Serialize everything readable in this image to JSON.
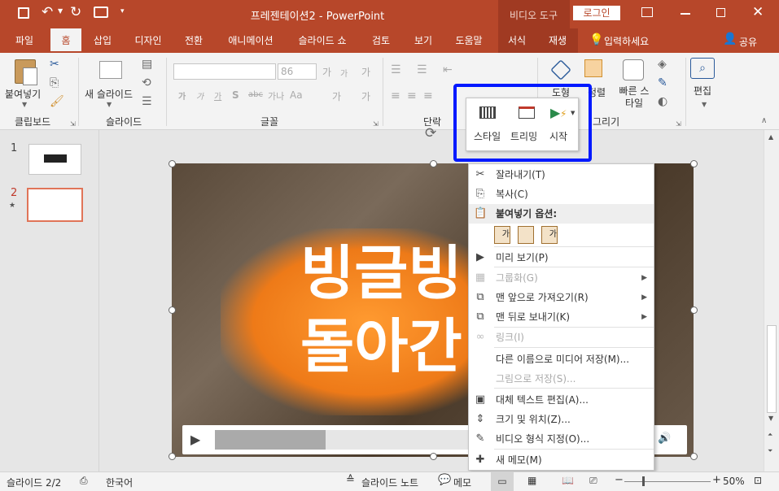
{
  "titlebar": {
    "title": "프레젠테이션2 - PowerPoint",
    "video_tools": "비디오 도구",
    "login": "로그인"
  },
  "tabs": [
    "파일",
    "홈",
    "삽입",
    "디자인",
    "전환",
    "애니메이션",
    "슬라이드 쇼",
    "검토",
    "보기",
    "도움말",
    "서식",
    "재생"
  ],
  "active_tab": "홈",
  "tell_me": "입력하세요",
  "share": "공유",
  "ribbon": {
    "clipboard": "클립보드",
    "paste": "붙여넣기",
    "slides": "슬라이드",
    "new_slide": "새 슬라이드",
    "font": "글꼴",
    "font_size": "86",
    "font_size_up": "가",
    "font_size_down": "가",
    "clear_format": "가",
    "bold": "가",
    "italic": "가",
    "underline": "가",
    "strike": "S",
    "shadow": "abc",
    "spacing": "가나",
    "change_case": "Aa",
    "highlight": "가",
    "font_color": "가",
    "paragraph": "단락",
    "drawing": "그리기",
    "shape": "도형",
    "arrange": "정렬",
    "quick_style": "빠른 스타일",
    "edit": "편집"
  },
  "minitoolbar": {
    "style": "스타일",
    "trim": "트리밍",
    "start": "시작"
  },
  "thumbs": [
    {
      "num": "1",
      "star": ""
    },
    {
      "num": "2",
      "star": "★"
    }
  ],
  "slide_text": [
    "빙글빙",
    "돌아간"
  ],
  "context_menu": [
    {
      "icon": "scissors-icon",
      "glyph": "✂",
      "label": "잘라내기(T)",
      "disabled": false
    },
    {
      "icon": "copy-icon",
      "glyph": "⎘",
      "label": "복사(C)",
      "disabled": false
    },
    {
      "icon": "paste-icon",
      "glyph": "📋",
      "label": "붙여넣기 옵션:",
      "disabled": false,
      "header": true
    },
    {
      "icon": "play-icon",
      "glyph": "▶",
      "label": "미리 보기(P)",
      "disabled": false
    },
    {
      "icon": "group-icon",
      "glyph": "▦",
      "label": "그룹화(G)",
      "disabled": true,
      "submenu": true
    },
    {
      "icon": "bring-front-icon",
      "glyph": "⧉",
      "label": "맨 앞으로 가져오기(R)",
      "disabled": false,
      "submenu": true
    },
    {
      "icon": "send-back-icon",
      "glyph": "⧉",
      "label": "맨 뒤로 보내기(K)",
      "disabled": false,
      "submenu": true
    },
    {
      "icon": "link-icon",
      "glyph": "∞",
      "label": "링크(I)",
      "disabled": true
    },
    {
      "icon": "",
      "glyph": "",
      "label": "다른 이름으로 미디어 저장(M)...",
      "disabled": false
    },
    {
      "icon": "",
      "glyph": "",
      "label": "그림으로 저장(S)...",
      "disabled": true
    },
    {
      "icon": "alt-text-icon",
      "glyph": "▣",
      "label": "대체 텍스트 편집(A)...",
      "disabled": false
    },
    {
      "icon": "size-position-icon",
      "glyph": "⇕",
      "label": "크기 및 위치(Z)...",
      "disabled": false
    },
    {
      "icon": "format-video-icon",
      "glyph": "✎",
      "label": "비디오 형식 지정(O)...",
      "disabled": false
    },
    {
      "icon": "new-comment-icon",
      "glyph": "✚",
      "label": "새 메모(M)",
      "disabled": false
    }
  ],
  "paste_option_label": "가",
  "status": {
    "slide": "슬라이드 2/2",
    "lang": "한국어",
    "notes": "슬라이드 노트",
    "comments": "메모",
    "zoom": "50%"
  }
}
